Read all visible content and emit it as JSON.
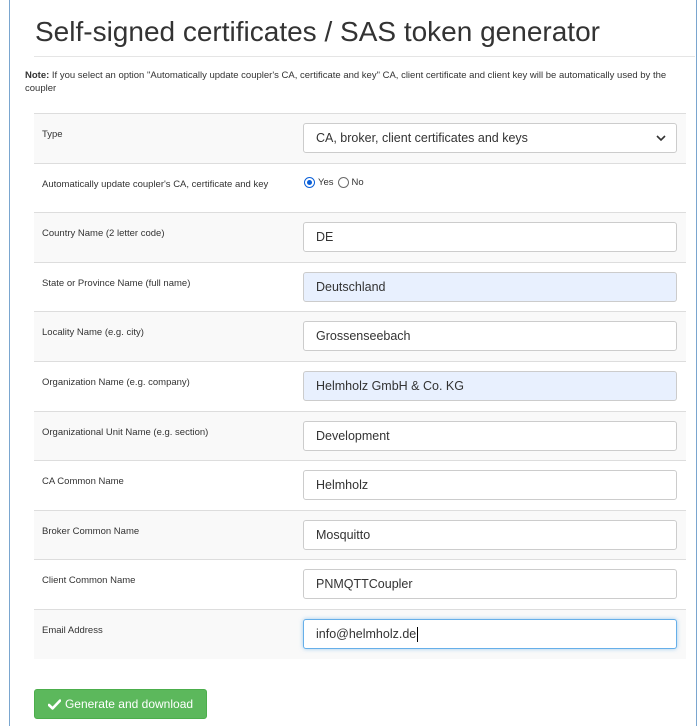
{
  "page": {
    "title": "Self-signed certificates / SAS token generator",
    "note_label": "Note:",
    "note_text": " If you select an option \"Automatically update coupler's CA, certificate and key\" CA, client certificate and client key will be automatically used by the coupler"
  },
  "form": {
    "type": {
      "label": "Type",
      "value": "CA, broker, client certificates and keys",
      "icon": "chevron-down-icon"
    },
    "auto_update": {
      "label": "Automatically update coupler's CA, certificate and key",
      "yes_label": "Yes",
      "no_label": "No",
      "selected": "Yes"
    },
    "country": {
      "label": "Country Name (2 letter code)",
      "value": "DE"
    },
    "state": {
      "label": "State or Province Name (full name)",
      "value": "Deutschland"
    },
    "locality": {
      "label": "Locality Name (e.g. city)",
      "value": "Grossenseebach"
    },
    "organization": {
      "label": "Organization Name (e.g. company)",
      "value": "Helmholz GmbH & Co. KG"
    },
    "org_unit": {
      "label": "Organizational Unit Name (e.g. section)",
      "value": "Development"
    },
    "ca_cn": {
      "label": "CA Common Name",
      "value": "Helmholz"
    },
    "broker_cn": {
      "label": "Broker Common Name",
      "value": "Mosquitto"
    },
    "client_cn": {
      "label": "Client Common Name",
      "value": "PNMQTTCoupler"
    },
    "email": {
      "label": "Email Address",
      "value": "info@helmholz.de"
    }
  },
  "actions": {
    "generate_label": "Generate and download",
    "generate_icon": "check-icon"
  },
  "colors": {
    "button_green": "#5cb85c",
    "autofill_bg": "#e8f0fe",
    "radio_blue": "#0b60d8",
    "focus_border": "#66afe9"
  }
}
